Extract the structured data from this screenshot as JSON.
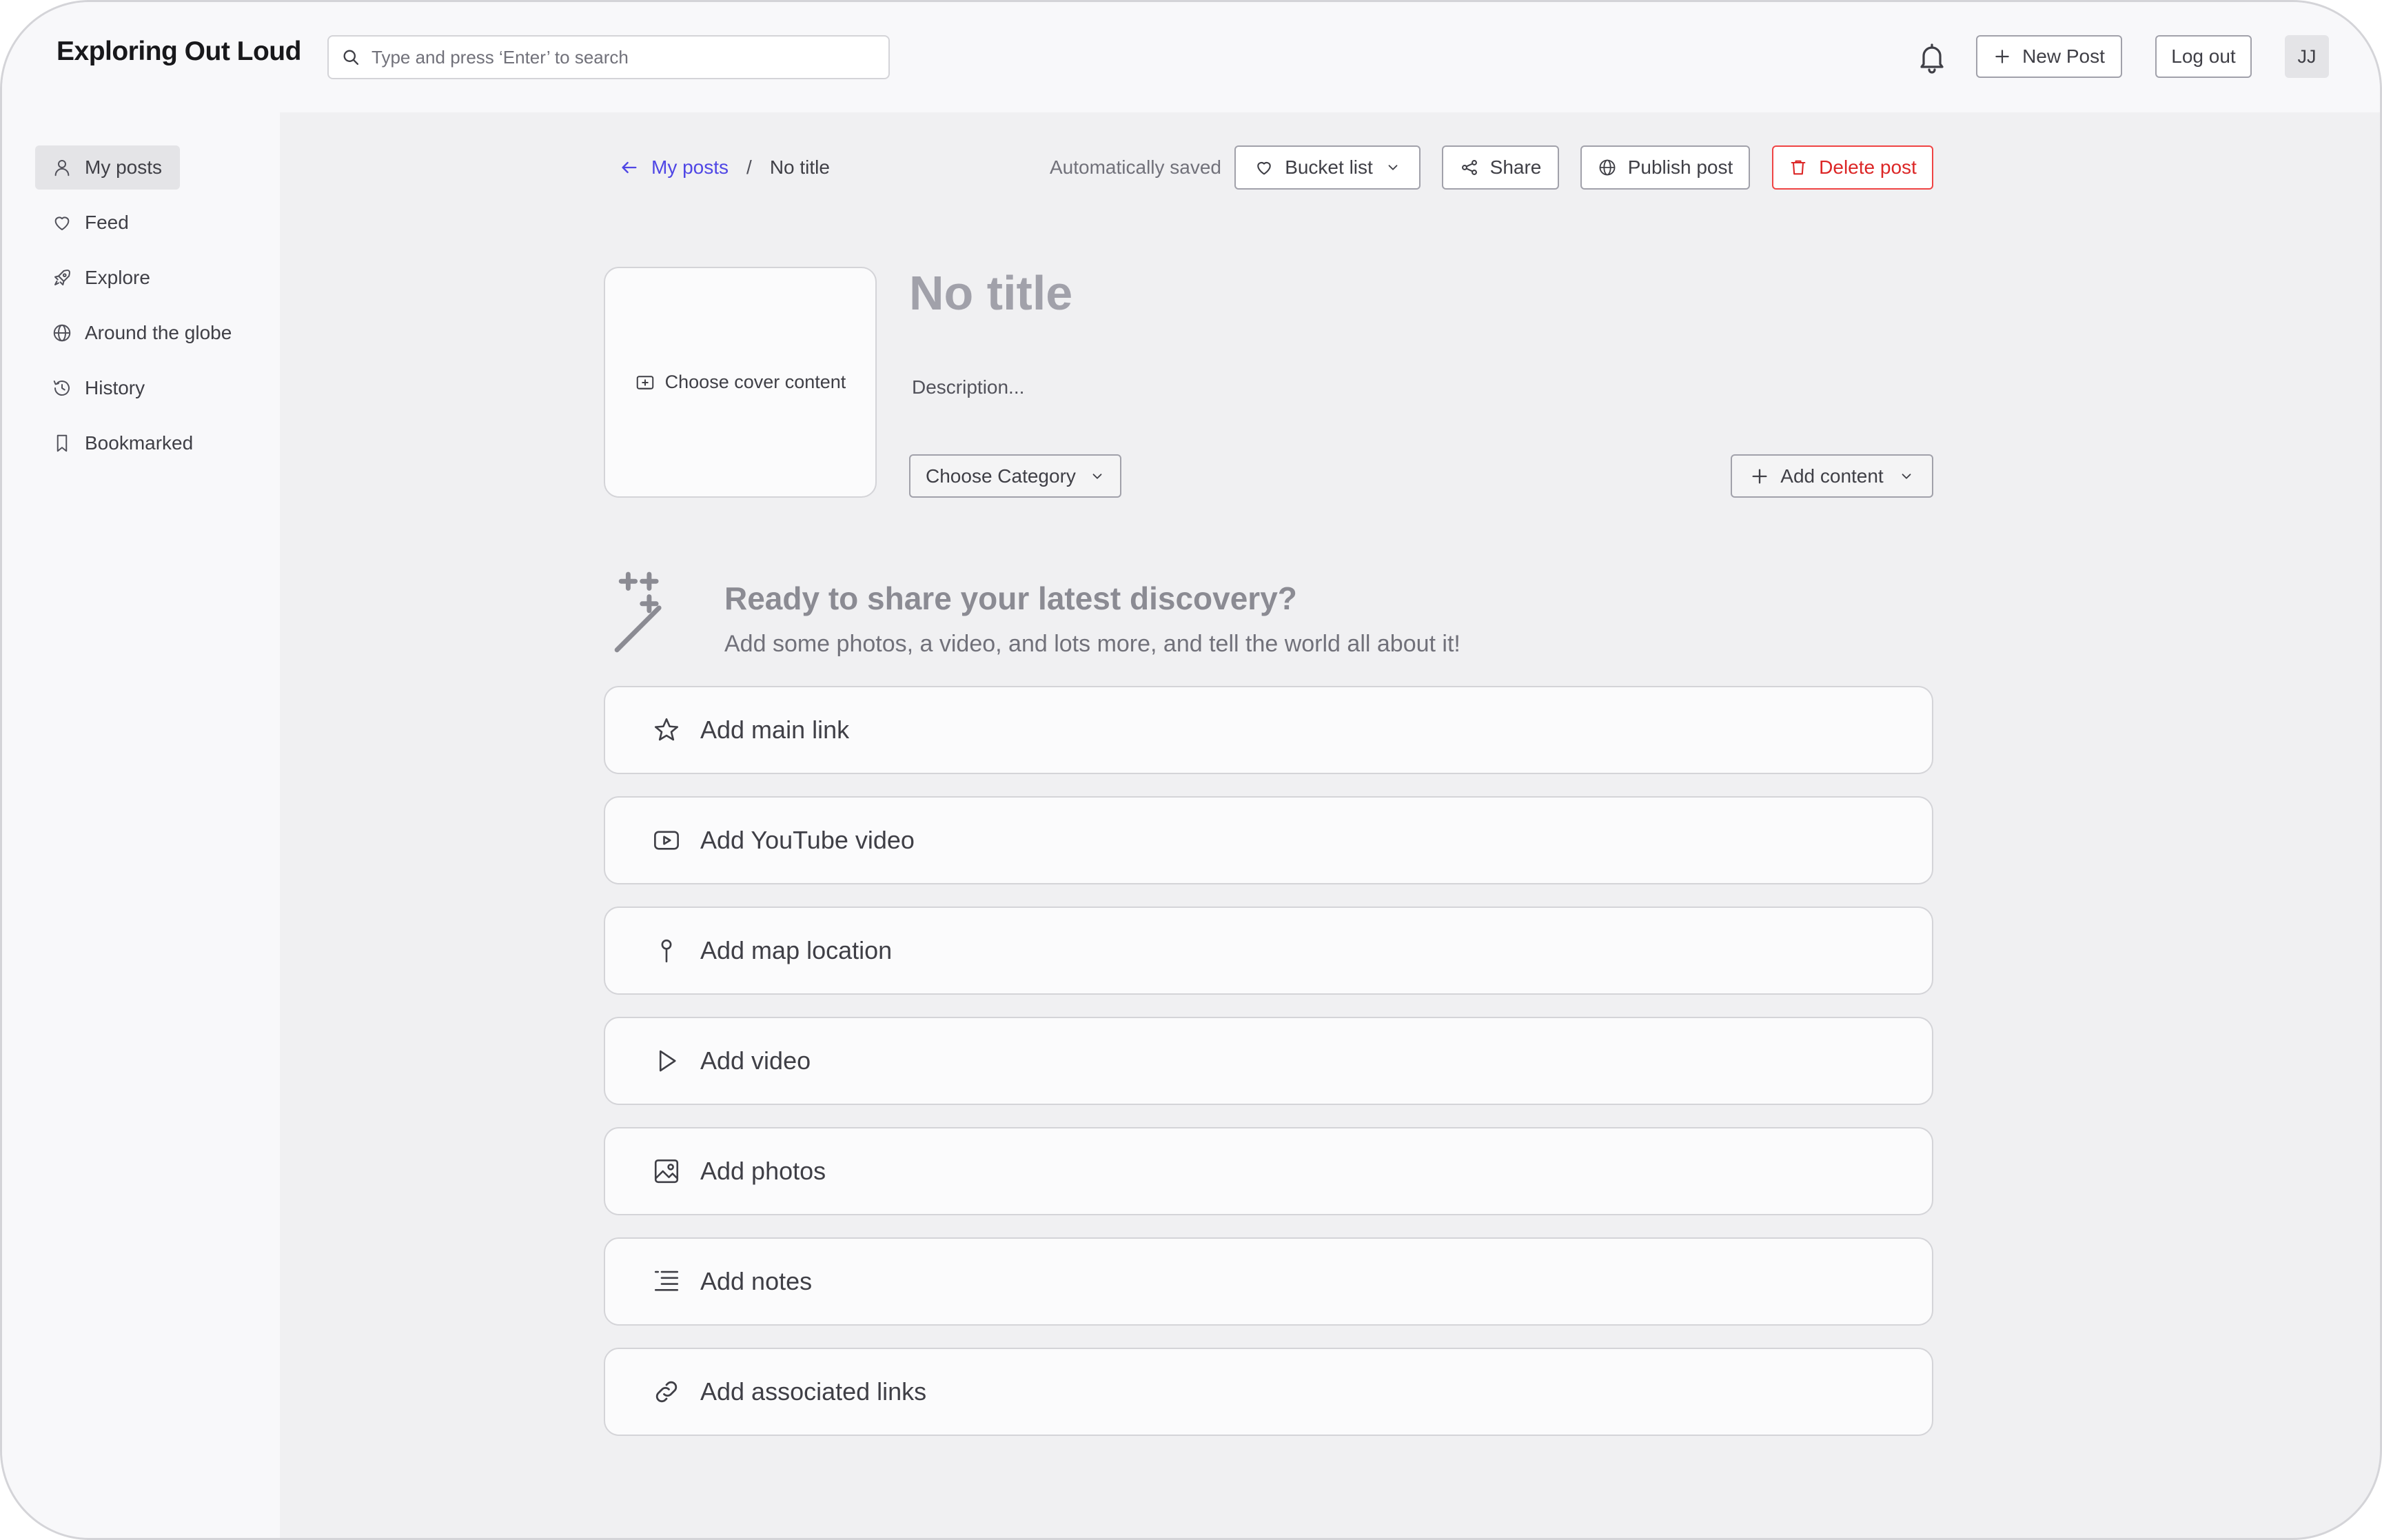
{
  "app": {
    "title": "Exploring Out Loud"
  },
  "search": {
    "placeholder": "Type and press ‘Enter’ to search"
  },
  "header": {
    "new_post": "New Post",
    "log_out": "Log out",
    "avatar_initials": "JJ"
  },
  "sidebar": {
    "items": [
      {
        "label": "My posts",
        "icon": "user-icon",
        "active": true
      },
      {
        "label": "Feed",
        "icon": "heart-icon",
        "active": false
      },
      {
        "label": "Explore",
        "icon": "rocket-icon",
        "active": false
      },
      {
        "label": "Around the globe",
        "icon": "globe-icon",
        "active": false
      },
      {
        "label": "History",
        "icon": "history-icon",
        "active": false
      },
      {
        "label": "Bookmarked",
        "icon": "bookmark-icon",
        "active": false
      }
    ]
  },
  "breadcrumb": {
    "back_label": "My posts",
    "separator": "/",
    "current": "No title"
  },
  "toolbar": {
    "status": "Automatically saved",
    "bucket_list": "Bucket list",
    "share": "Share",
    "publish": "Publish post",
    "delete": "Delete post"
  },
  "post": {
    "cover_label": "Choose cover content",
    "title_placeholder": "No title",
    "description_placeholder": "Description...",
    "category_label": "Choose Category",
    "add_content_label": "Add content"
  },
  "prompt": {
    "heading": "Ready to share your latest discovery?",
    "subtext": "Add some photos, a video, and lots more, and tell the world all about it!"
  },
  "content_options": [
    {
      "label": "Add main link",
      "icon": "star-icon"
    },
    {
      "label": "Add YouTube video",
      "icon": "youtube-icon"
    },
    {
      "label": "Add map location",
      "icon": "map-pin-icon"
    },
    {
      "label": "Add video",
      "icon": "play-icon"
    },
    {
      "label": "Add photos",
      "icon": "image-icon"
    },
    {
      "label": "Add notes",
      "icon": "list-icon"
    },
    {
      "label": "Add associated links",
      "icon": "link-icon"
    }
  ],
  "colors": {
    "accent": "#4f46e5",
    "danger": "#dc2626",
    "sidebar_bg": "#f8f8fa",
    "content_bg": "#f0f0f2"
  }
}
